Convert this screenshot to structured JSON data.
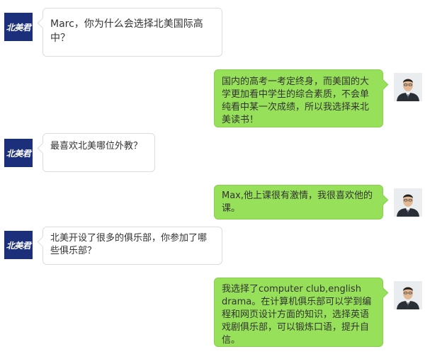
{
  "brand": {
    "logo_text": "北美君",
    "logo_color": "#1c2f7a"
  },
  "colors": {
    "sent_bubble": "#97e15a",
    "received_bubble": "#ffffff"
  },
  "messages": [
    {
      "side": "left",
      "sender": "北美君",
      "text": "Marc，你为什么会选择北美国际高中？"
    },
    {
      "side": "right",
      "sender": "student",
      "text": "国内的高考一考定终身，而美国的大学更加看中学生的综合素质，不会单纯看中某一次成绩，所以我选择来北美读书！"
    },
    {
      "side": "left",
      "sender": "北美君",
      "text": "最喜欢北美哪位外教？"
    },
    {
      "side": "right",
      "sender": "student",
      "text": "Max,他上课很有激情，我很喜欢他的课。"
    },
    {
      "side": "left",
      "sender": "北美君",
      "text": "北美开设了很多的俱乐部，你参加了哪些俱乐部？"
    },
    {
      "side": "right",
      "sender": "student",
      "text": "我选择了computer club,english drama。在计算机俱乐部可以学到编程和网页设计方面的知识，选择英语戏剧俱乐部，可以锻炼口语，提升自信。"
    }
  ]
}
